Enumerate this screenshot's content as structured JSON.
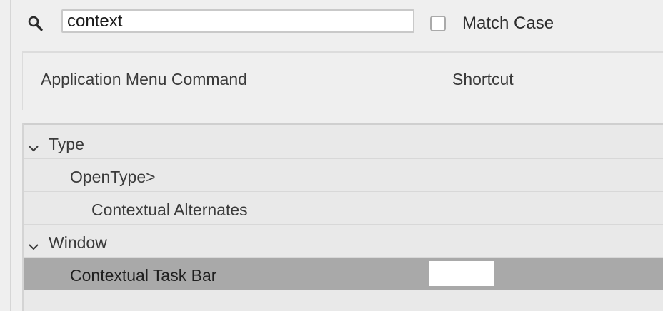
{
  "search": {
    "query": "context",
    "match_case_label": "Match Case",
    "match_case_checked": false
  },
  "columns": {
    "command": "Application Menu Command",
    "shortcut": "Shortcut"
  },
  "rows": [
    {
      "label": "Type",
      "kind": "group",
      "expanded": true
    },
    {
      "label": "OpenType>",
      "kind": "submenu"
    },
    {
      "label": "Contextual Alternates",
      "kind": "command"
    },
    {
      "label": "Window",
      "kind": "group",
      "expanded": true
    },
    {
      "label": "Contextual Task Bar",
      "kind": "command",
      "selected": true,
      "shortcut": ""
    }
  ],
  "colors": {
    "selected_row": "#a9a9a9",
    "background": "#efefef"
  }
}
